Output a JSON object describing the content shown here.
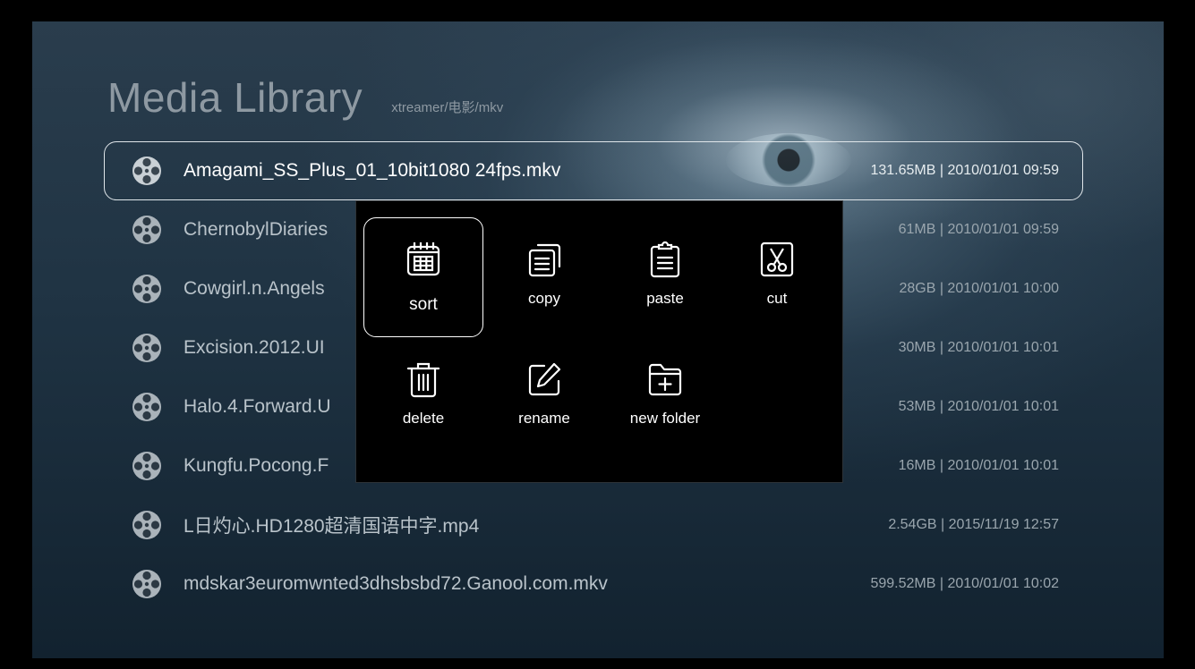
{
  "header": {
    "title": "Media Library",
    "path": "xtreamer/电影/mkv"
  },
  "files": [
    {
      "name": "Amagami_SS_Plus_01_10bit1080 24fps.mkv",
      "meta": "131.65MB | 2010/01/01 09:59",
      "selected": true,
      "icon": "film-reel-icon"
    },
    {
      "name": "ChernobylDiaries",
      "meta": "61MB | 2010/01/01 09:59",
      "selected": false,
      "icon": "film-reel-icon"
    },
    {
      "name": "Cowgirl.n.Angels",
      "meta": "28GB | 2010/01/01 10:00",
      "selected": false,
      "icon": "film-reel-icon"
    },
    {
      "name": "Excision.2012.UI",
      "meta": "30MB | 2010/01/01 10:01",
      "selected": false,
      "icon": "film-reel-icon"
    },
    {
      "name": "Halo.4.Forward.U",
      "meta": "53MB | 2010/01/01 10:01",
      "selected": false,
      "icon": "film-reel-icon"
    },
    {
      "name": "Kungfu.Pocong.F",
      "meta": "16MB | 2010/01/01 10:01",
      "selected": false,
      "icon": "film-reel-icon"
    },
    {
      "name": "L日灼心.HD1280超清国语中字.mp4",
      "meta": "2.54GB | 2015/11/19 12:57",
      "selected": false,
      "icon": "film-reel-icon"
    },
    {
      "name": "mdskar3euromwnted3dhsbsbd72.Ganool.com.mkv",
      "meta": "599.52MB | 2010/01/01 10:02",
      "selected": false,
      "icon": "film-reel-icon"
    }
  ],
  "menu": {
    "items": [
      {
        "label": "sort",
        "icon": "calendar-grid-icon",
        "focused": true
      },
      {
        "label": "copy",
        "icon": "copy-icon",
        "focused": false
      },
      {
        "label": "paste",
        "icon": "clipboard-icon",
        "focused": false
      },
      {
        "label": "cut",
        "icon": "scissors-icon",
        "focused": false
      },
      {
        "label": "delete",
        "icon": "trash-icon",
        "focused": false
      },
      {
        "label": "rename",
        "icon": "edit-icon",
        "focused": false
      },
      {
        "label": "new folder",
        "icon": "new-folder-icon",
        "focused": false
      }
    ]
  },
  "colors": {
    "text_primary": "#ffffff",
    "text_secondary": "#b9c3ca",
    "menu_background": "#000000",
    "focus_border": "#ffffff"
  }
}
